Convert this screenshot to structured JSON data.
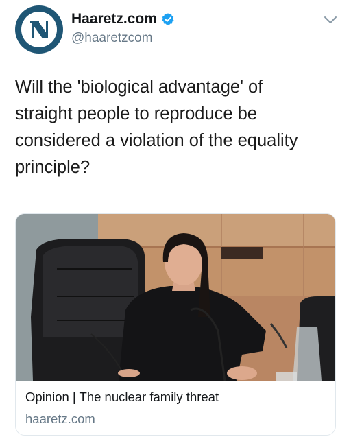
{
  "tweet": {
    "display_name": "Haaretz.com",
    "handle": "@haaretzcom",
    "text_lines": [
      "Will the 'biological advantage' of",
      "straight people to reproduce be",
      "considered a violation of the equality",
      "principle?"
    ],
    "icons": {
      "avatar": "haaretz-logo",
      "verified": "verified-badge-icon",
      "menu": "chevron-down-icon"
    },
    "colors": {
      "avatar_bg": "#1f5675",
      "verified": "#1da1f2",
      "handle": "#657786"
    }
  },
  "card": {
    "title": "Opinion | The nuclear family threat",
    "domain": "haaretz.com"
  }
}
